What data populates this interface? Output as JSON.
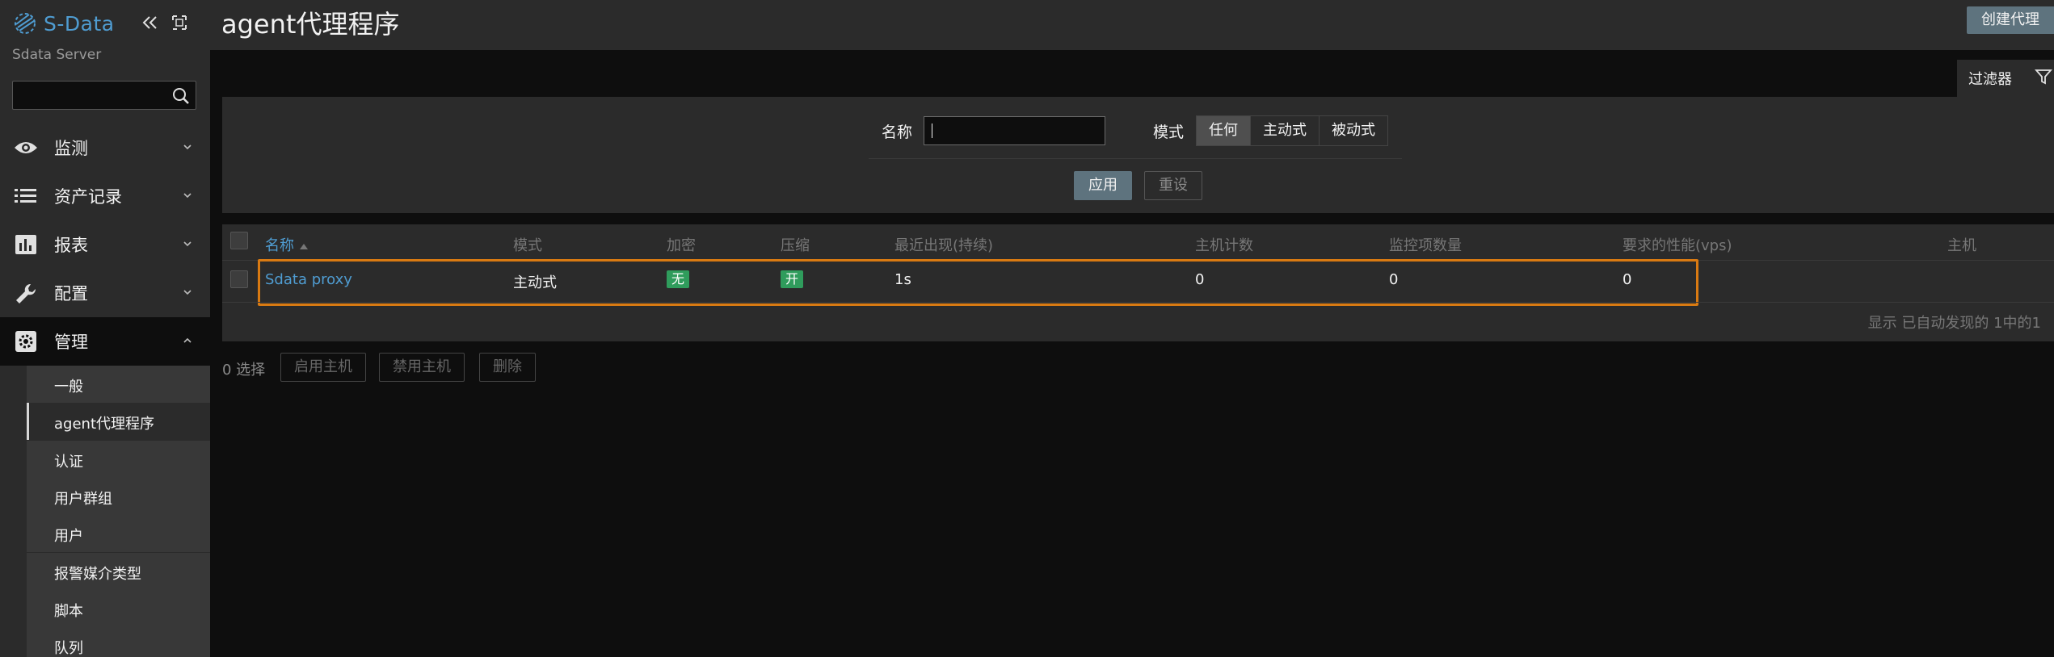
{
  "app": {
    "logo_text": "S-Data",
    "server_name": "Sdata Server",
    "search_placeholder": ""
  },
  "sidebar": {
    "menus": [
      {
        "label": "监测",
        "icon": "eye-icon"
      },
      {
        "label": "资产记录",
        "icon": "list-icon"
      },
      {
        "label": "报表",
        "icon": "bar-chart-icon"
      },
      {
        "label": "配置",
        "icon": "wrench-icon"
      },
      {
        "label": "管理",
        "icon": "gear-icon"
      }
    ],
    "admin_items": [
      {
        "label": "一般"
      },
      {
        "label": "agent代理程序"
      },
      {
        "label": "认证"
      },
      {
        "label": "用户群组"
      },
      {
        "label": "用户"
      },
      {
        "label": "报警媒介类型"
      },
      {
        "label": "脚本"
      },
      {
        "label": "队列"
      }
    ]
  },
  "header": {
    "title": "agent代理程序",
    "create_label": "创建代理"
  },
  "filter": {
    "tab_label": "过滤器",
    "name_label": "名称",
    "name_value": "",
    "mode_label": "模式",
    "mode_options": [
      "任何",
      "主动式",
      "被动式"
    ],
    "mode_selected": "任何",
    "apply_label": "应用",
    "reset_label": "重设"
  },
  "table": {
    "columns": [
      "名称",
      "模式",
      "加密",
      "压缩",
      "最近出现(持续)",
      "主机计数",
      "监控项数量",
      "要求的性能(vps)",
      "主机"
    ],
    "sort_column": "名称",
    "rows": [
      {
        "name": "Sdata proxy",
        "mode": "主动式",
        "encryption": "无",
        "compression": "开",
        "last_seen": "1s",
        "host_count": "0",
        "item_count": "0",
        "required_vps": "0",
        "hosts": ""
      }
    ],
    "displayed_text": "显示 已自动发现的 1中的1"
  },
  "footer": {
    "selected_text": "0 选择",
    "enable_label": "启用主机",
    "disable_label": "禁用主机",
    "delete_label": "删除"
  },
  "colors": {
    "accent": "#4f9cd1",
    "highlight": "#d97a12",
    "badge_green": "#2f9c5c",
    "button": "#5e737e"
  }
}
